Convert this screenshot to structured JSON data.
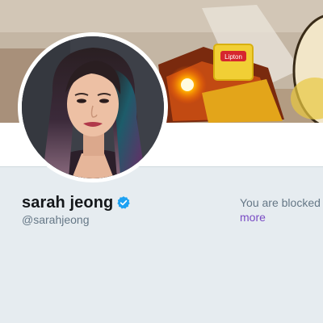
{
  "profile": {
    "name": "sarah jeong",
    "handle": "@sarahjeong",
    "verified": true
  },
  "banner": {
    "tea_tag_text": "Lipton"
  },
  "notice": {
    "blocked_text": "You are blocked fr",
    "link_text": "more"
  },
  "colors": {
    "page_bg": "#e6ecf0",
    "verified": "#1da1f2",
    "link": "#794bc4",
    "muted_text": "#657786",
    "name_text": "#14171a"
  },
  "icons": {
    "verified": "verified-badge-icon"
  }
}
